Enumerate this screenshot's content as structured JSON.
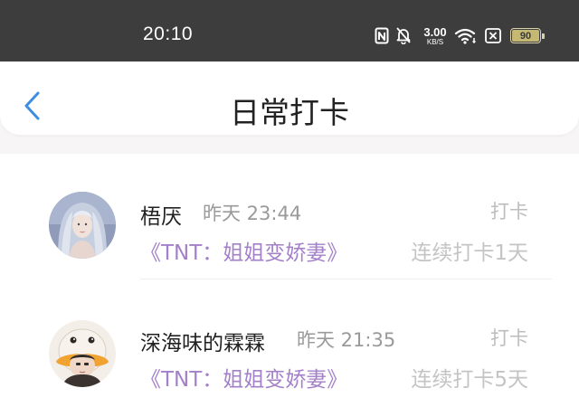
{
  "status_bar": {
    "time": "20:10",
    "net_speed_value": "3.00",
    "net_speed_unit": "KB/S",
    "battery_level": "90",
    "icons": [
      "nfc-icon",
      "mute-icon",
      "wifi-icon",
      "sim-off-icon",
      "battery-icon"
    ]
  },
  "header": {
    "back_icon": "chevron-left-icon",
    "title": "日常打卡"
  },
  "list": [
    {
      "user": "梧厌",
      "time": "昨天 23:44",
      "tag": "打卡",
      "book": "《TNT：姐姐变娇妻》",
      "streak": "连续打卡1天"
    },
    {
      "user": "深海味的霖霖",
      "time": "昨天 21:35",
      "tag": "打卡",
      "book": "《TNT：姐姐变娇妻》",
      "streak": "连续打卡5天"
    }
  ],
  "colors": {
    "status_bar_bg": "#3d3d3d",
    "accent_blue": "#3d8ee0",
    "book_link_purple": "#a480c9",
    "page_bg": "#f7f5f6"
  }
}
